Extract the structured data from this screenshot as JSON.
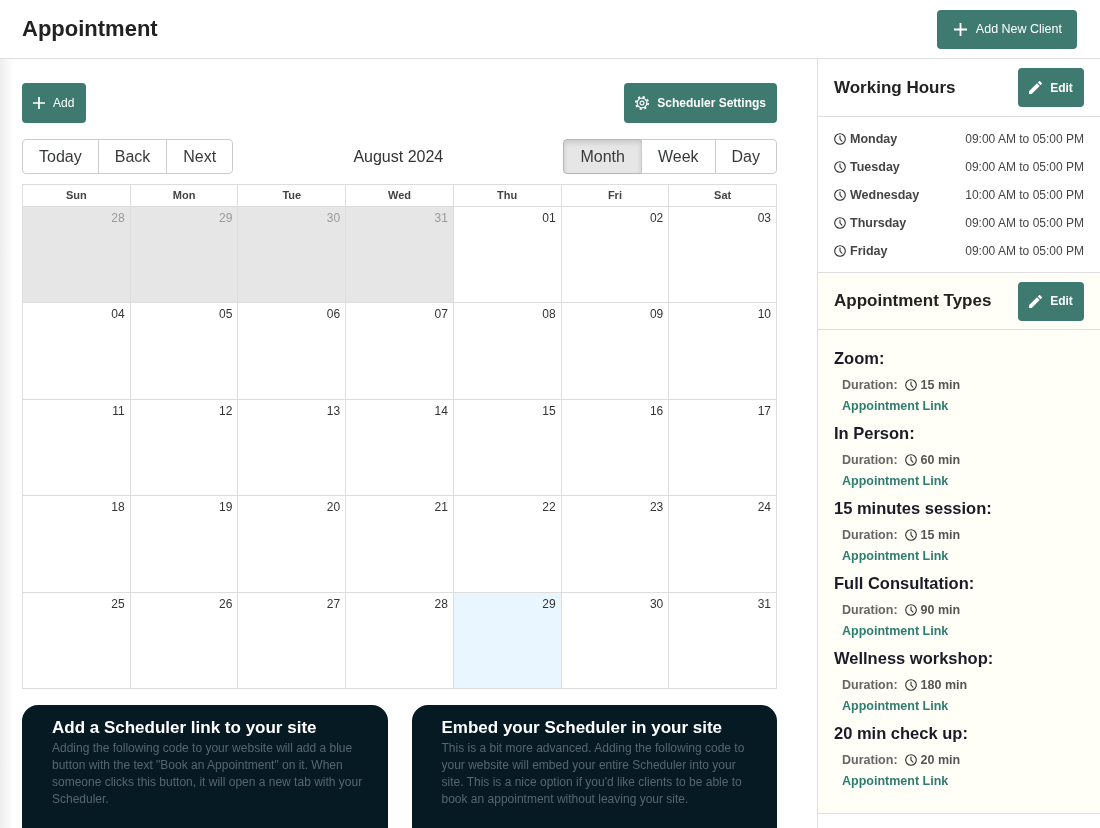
{
  "header": {
    "title": "Appointment",
    "add_client_button": "Add New Client"
  },
  "toolbar": {
    "add_button": "Add",
    "settings_button": "Scheduler Settings"
  },
  "calendar": {
    "nav_buttons": [
      "Today",
      "Back",
      "Next"
    ],
    "period_label": "August 2024",
    "views": [
      {
        "label": "Month",
        "selected": true
      },
      {
        "label": "Week",
        "selected": false
      },
      {
        "label": "Day",
        "selected": false
      }
    ],
    "weekdays": [
      "Sun",
      "Mon",
      "Tue",
      "Wed",
      "Thu",
      "Fri",
      "Sat"
    ],
    "weeks": [
      [
        {
          "date": "28",
          "outside_month": true,
          "today": false
        },
        {
          "date": "29",
          "outside_month": true,
          "today": false
        },
        {
          "date": "30",
          "outside_month": true,
          "today": false
        },
        {
          "date": "31",
          "outside_month": true,
          "today": false
        },
        {
          "date": "01",
          "outside_month": false,
          "today": false
        },
        {
          "date": "02",
          "outside_month": false,
          "today": false
        },
        {
          "date": "03",
          "outside_month": false,
          "today": false
        }
      ],
      [
        {
          "date": "04",
          "outside_month": false,
          "today": false
        },
        {
          "date": "05",
          "outside_month": false,
          "today": false
        },
        {
          "date": "06",
          "outside_month": false,
          "today": false
        },
        {
          "date": "07",
          "outside_month": false,
          "today": false
        },
        {
          "date": "08",
          "outside_month": false,
          "today": false
        },
        {
          "date": "09",
          "outside_month": false,
          "today": false
        },
        {
          "date": "10",
          "outside_month": false,
          "today": false
        }
      ],
      [
        {
          "date": "11",
          "outside_month": false,
          "today": false
        },
        {
          "date": "12",
          "outside_month": false,
          "today": false
        },
        {
          "date": "13",
          "outside_month": false,
          "today": false
        },
        {
          "date": "14",
          "outside_month": false,
          "today": false
        },
        {
          "date": "15",
          "outside_month": false,
          "today": false
        },
        {
          "date": "16",
          "outside_month": false,
          "today": false
        },
        {
          "date": "17",
          "outside_month": false,
          "today": false
        }
      ],
      [
        {
          "date": "18",
          "outside_month": false,
          "today": false
        },
        {
          "date": "19",
          "outside_month": false,
          "today": false
        },
        {
          "date": "20",
          "outside_month": false,
          "today": false
        },
        {
          "date": "21",
          "outside_month": false,
          "today": false
        },
        {
          "date": "22",
          "outside_month": false,
          "today": false
        },
        {
          "date": "23",
          "outside_month": false,
          "today": false
        },
        {
          "date": "24",
          "outside_month": false,
          "today": false
        }
      ],
      [
        {
          "date": "25",
          "outside_month": false,
          "today": false
        },
        {
          "date": "26",
          "outside_month": false,
          "today": false
        },
        {
          "date": "27",
          "outside_month": false,
          "today": false
        },
        {
          "date": "28",
          "outside_month": false,
          "today": false
        },
        {
          "date": "29",
          "outside_month": false,
          "today": true
        },
        {
          "date": "30",
          "outside_month": false,
          "today": false
        },
        {
          "date": "31",
          "outside_month": false,
          "today": false
        }
      ]
    ]
  },
  "info_cards": [
    {
      "title": "Add a Scheduler link to your site",
      "text": "Adding the following code to your website will add a blue button with the text \"Book an Appointment\" on it. When someone clicks this button, it will open a new tab with your Scheduler."
    },
    {
      "title": "Embed your Scheduler in your site",
      "text": "This is a bit more advanced. Adding the following code to your website will embed your entire Scheduler into your site. This is a nice option if you'd like clients to be able to book an appointment without leaving your site."
    }
  ],
  "working_hours": {
    "title": "Working Hours",
    "edit_button": "Edit",
    "days": [
      {
        "day": "Monday",
        "hours": "09:00 AM to 05:00 PM"
      },
      {
        "day": "Tuesday",
        "hours": "09:00 AM to 05:00 PM"
      },
      {
        "day": "Wednesday",
        "hours": "10:00 AM to 05:00 PM"
      },
      {
        "day": "Thursday",
        "hours": "09:00 AM to 05:00 PM"
      },
      {
        "day": "Friday",
        "hours": "09:00 AM to 05:00 PM"
      }
    ]
  },
  "appointment_types": {
    "title": "Appointment Types",
    "edit_button": "Edit",
    "items": [
      {
        "name": "Zoom:",
        "duration_label": "Duration:",
        "duration": "15 min",
        "link": "Appointment Link"
      },
      {
        "name": "In Person:",
        "duration_label": "Duration:",
        "duration": "60 min",
        "link": "Appointment Link"
      },
      {
        "name": "15 minutes session:",
        "duration_label": "Duration:",
        "duration": "15 min",
        "link": "Appointment Link"
      },
      {
        "name": "Full Consultation:",
        "duration_label": "Duration:",
        "duration": "90 min",
        "link": "Appointment Link"
      },
      {
        "name": "Wellness workshop:",
        "duration_label": "Duration:",
        "duration": "180 min",
        "link": "Appointment Link"
      },
      {
        "name": "20 min check up:",
        "duration_label": "Duration:",
        "duration": "20 min",
        "link": "Appointment Link"
      }
    ]
  }
}
